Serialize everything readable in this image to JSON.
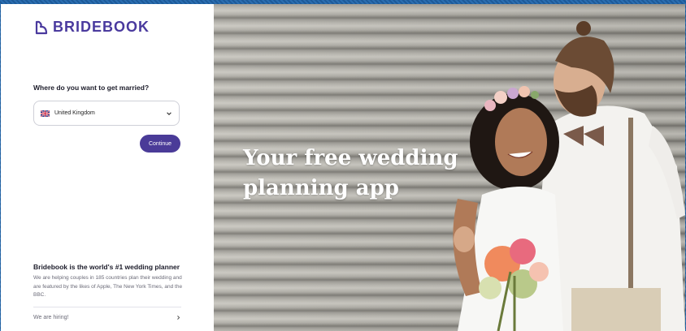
{
  "brand": {
    "name": "BRIDEBOOK"
  },
  "form": {
    "question": "Where do you want to get married?",
    "country_value": "United Kingdom",
    "continue_label": "Continue"
  },
  "promo": {
    "title": "Bridebook is the world's #1 wedding planner",
    "body": "We are helping couples in 185 countries plan their wedding and are featured by the likes of Apple, The New York Times, and the BBC.",
    "hiring_label": "We are hiring!"
  },
  "hero": {
    "title": "Your free wedding planning app"
  },
  "colors": {
    "brand": "#4a3b98",
    "frame": "#1f5f9f"
  },
  "icons": [
    "bridebook-logo-icon",
    "uk-flag-icon",
    "chevron-down-icon",
    "chevron-right-icon"
  ]
}
